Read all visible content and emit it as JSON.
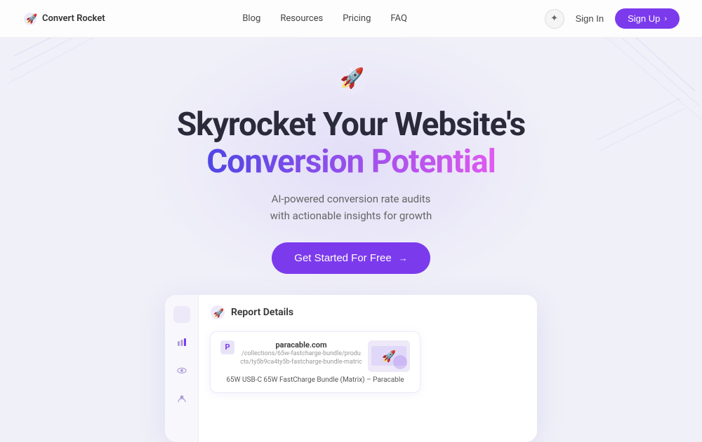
{
  "brand": {
    "name": "Convert Rocket",
    "logo_icon": "🚀"
  },
  "nav": {
    "links": [
      {
        "label": "Blog",
        "id": "blog"
      },
      {
        "label": "Resources",
        "id": "resources"
      },
      {
        "label": "Pricing",
        "id": "pricing"
      },
      {
        "label": "FAQ",
        "id": "faq"
      }
    ],
    "signin_label": "Sign In",
    "signup_label": "Sign Up",
    "theme_icon": "✦"
  },
  "hero": {
    "title_line1": "Skyrocket Your Website's",
    "title_line2": "Conversion Potential",
    "subtitle_line1": "AI-powered conversion rate audits",
    "subtitle_line2": "with actionable insights for growth",
    "cta_label": "Get Started For Free",
    "cta_arrow": "→"
  },
  "dashboard": {
    "report_title": "Report Details",
    "card": {
      "url": "paracable.com",
      "path": "/collections/65w-fastcharge-bundle/products/ty5b9ca4ty5b-fastcharge-bundle-matric",
      "product_name": "65W USB-C 65W FastCharge Bundle (Matrix) – Paracable"
    }
  }
}
